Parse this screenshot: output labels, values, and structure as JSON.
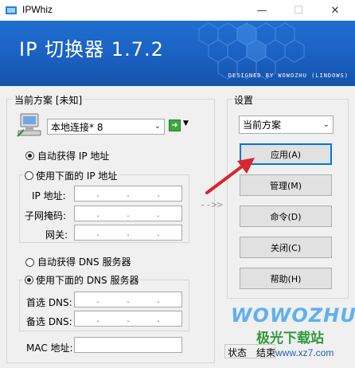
{
  "window": {
    "title": "IPWhiz"
  },
  "banner": {
    "title": "IP 切换器 1.7.2",
    "subtitle": "DESIGNED BY WOWOZHU (LINDOWS)"
  },
  "scheme_group": {
    "legend": "当前方案 [未知]",
    "adapter": "本地连接* 8",
    "auto_ip": "自动获得 IP 地址",
    "manual_ip": "使用下面的 IP 地址",
    "ip_label": "IP 地址:",
    "mask_label": "子网掩码:",
    "gateway_label": "网关:",
    "auto_dns": "自动获得 DNS 服务器",
    "manual_dns": "使用下面的 DNS 服务器",
    "dns1_label": "首选 DNS:",
    "dns2_label": "备选 DNS:",
    "mac_label": "MAC 地址:",
    "ip_dots": [
      ".",
      ".",
      "."
    ]
  },
  "arrow_hint": "-->>",
  "settings_group": {
    "legend": "设置",
    "scheme_select": "当前方案",
    "buttons": {
      "apply": "应用(A)",
      "manage": "管理(M)",
      "command": "命令(D)",
      "close": "关闭(C)",
      "help": "帮助(H)"
    }
  },
  "status": {
    "label": "状态",
    "value": "结束"
  },
  "watermarks": {
    "logo": "WOWOZHU",
    "site_name": "极光下载站",
    "site_url": "www.xz7.com"
  },
  "colors": {
    "banner": "#1a5fc0",
    "default_button_border": "#0078d7",
    "annotation_arrow": "#d9262b"
  }
}
